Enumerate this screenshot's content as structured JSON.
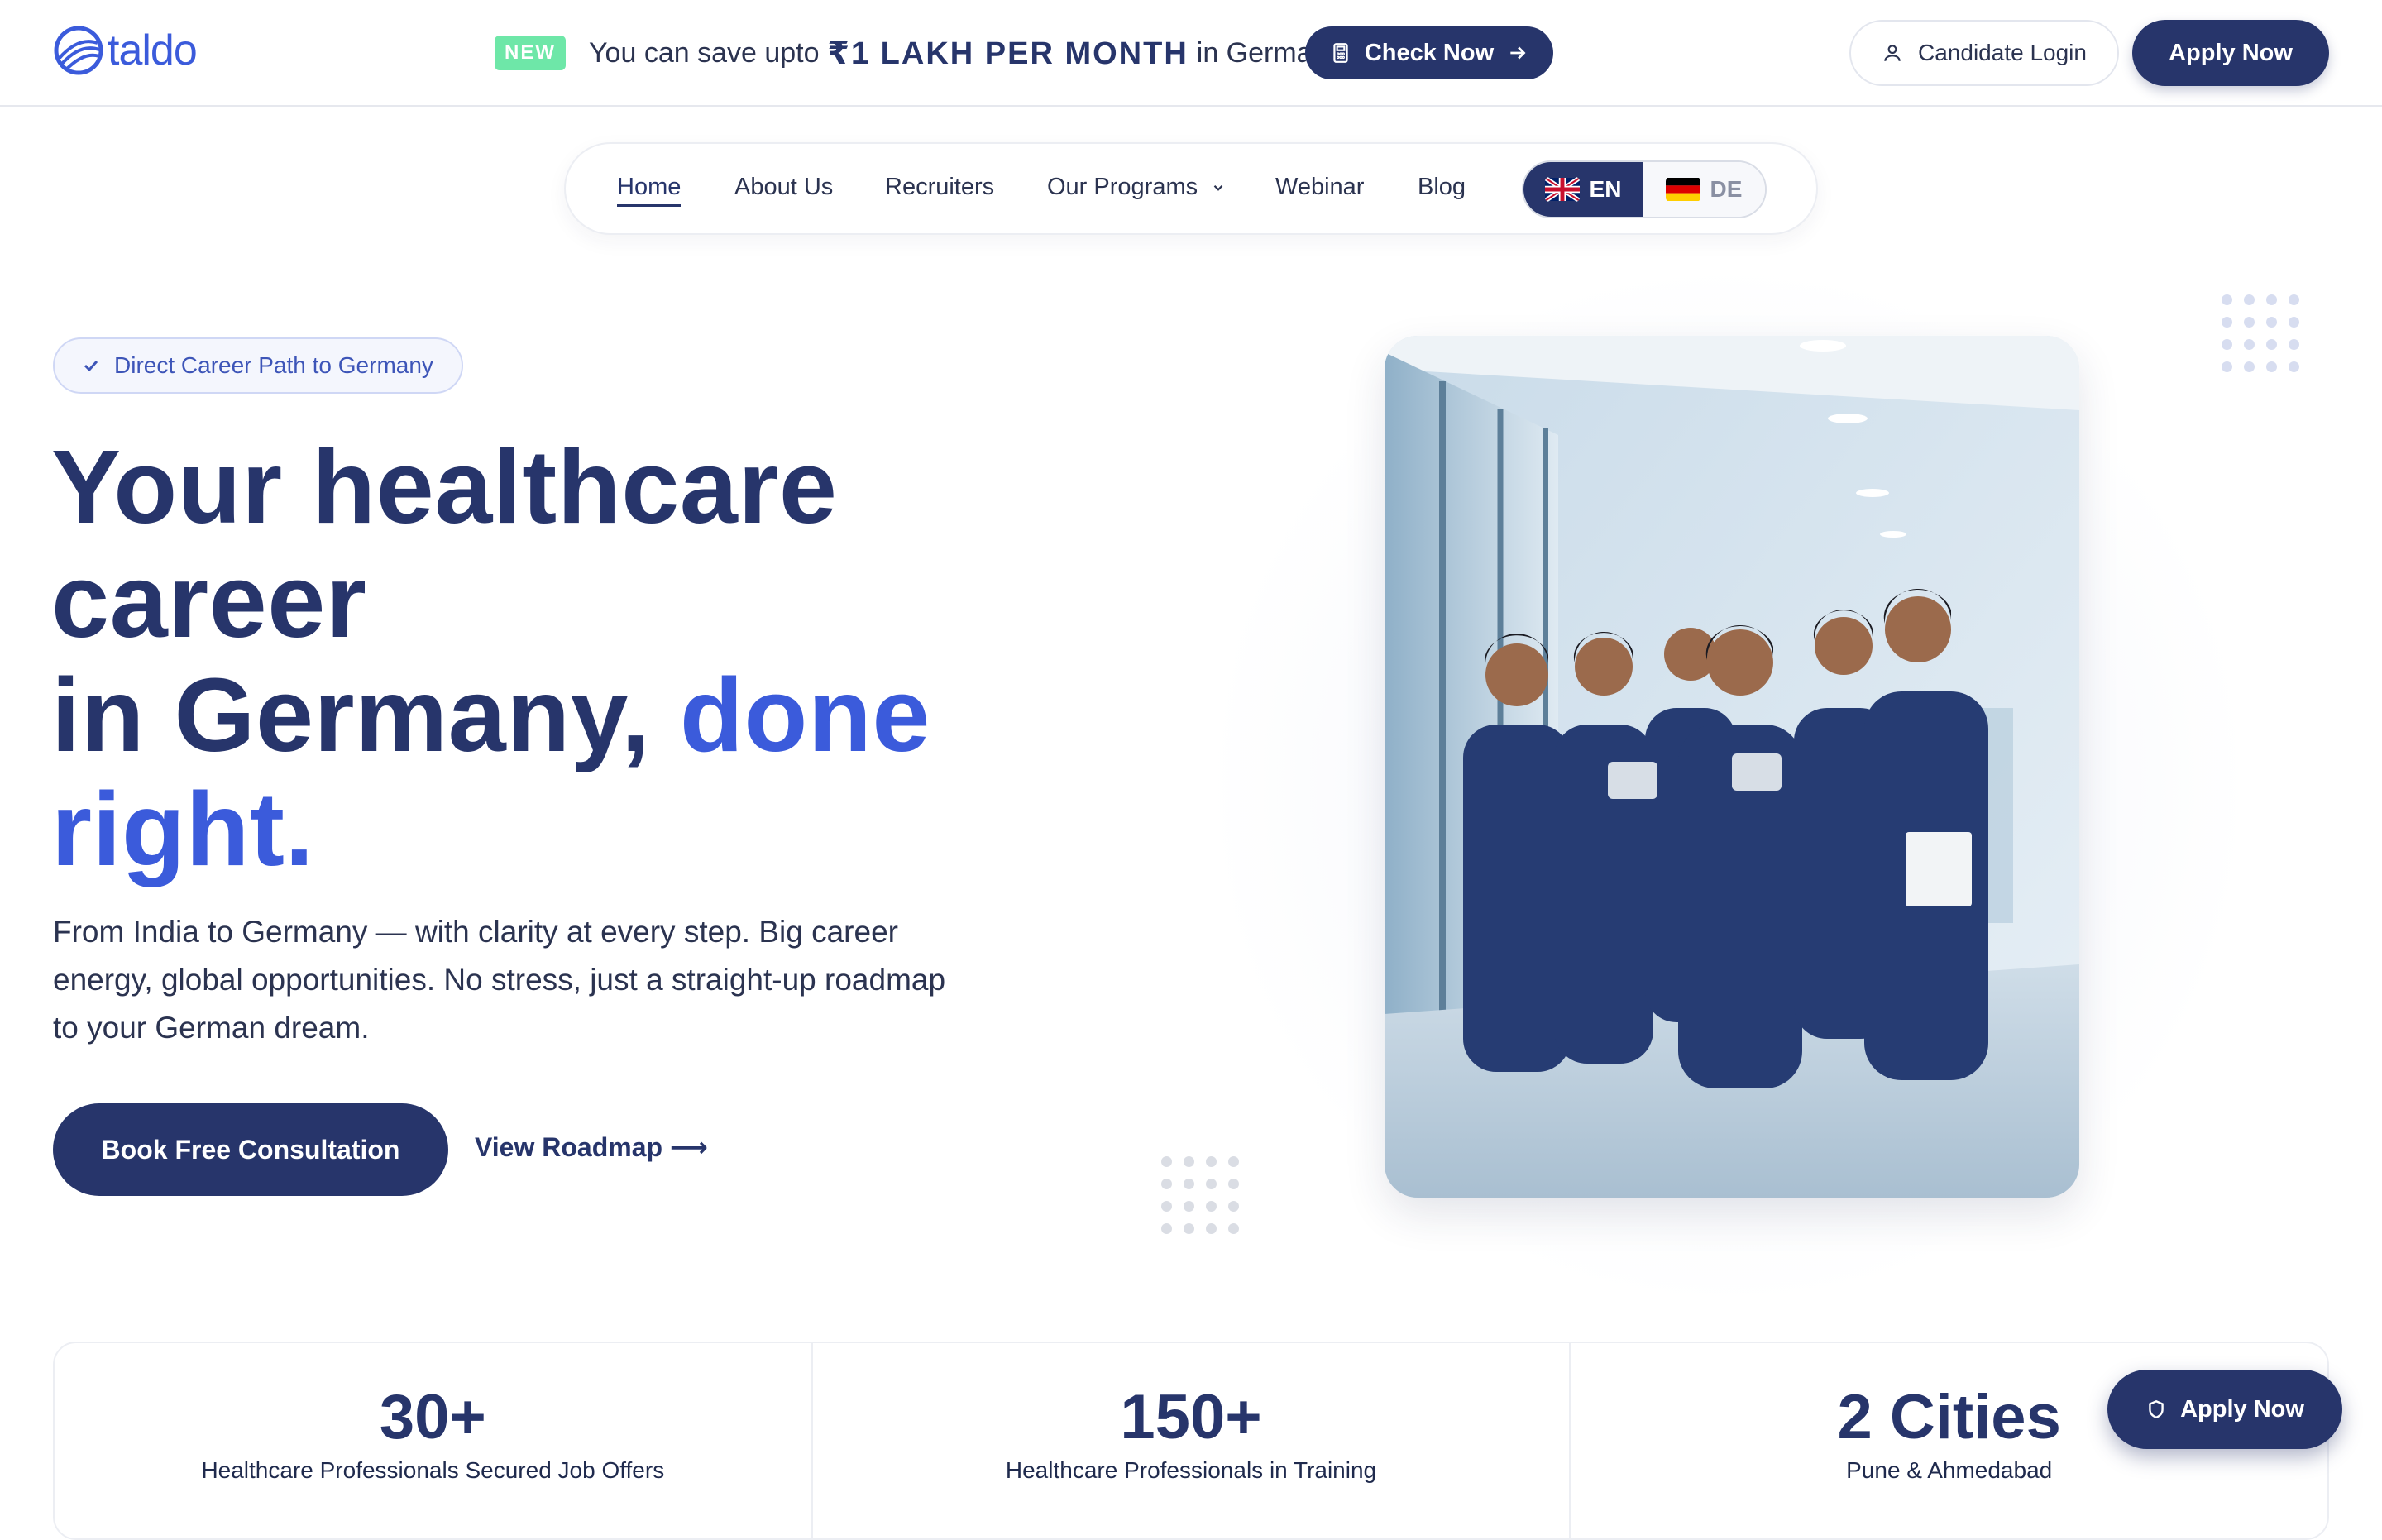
{
  "brand": {
    "name": "taldo",
    "logo_icon": "globe-logo-icon"
  },
  "promo": {
    "badge": "NEW",
    "text_pre": "You can save upto",
    "text_strong": "₹1 LAKH PER MONTH",
    "text_post": "in Germany",
    "cta_label": "Check Now",
    "cta_icon": "calculator-icon"
  },
  "header": {
    "login_label": "Candidate Login",
    "login_icon": "user-icon",
    "apply_label": "Apply Now"
  },
  "nav": {
    "items": [
      {
        "label": "Home",
        "active": true
      },
      {
        "label": "About Us"
      },
      {
        "label": "Recruiters"
      },
      {
        "label": "Our Programs",
        "has_dropdown": true
      },
      {
        "label": "Webinar"
      },
      {
        "label": "Blog"
      }
    ],
    "languages": [
      {
        "code": "EN",
        "flag": "uk-flag-icon",
        "selected": true
      },
      {
        "code": "DE",
        "flag": "germany-flag-icon",
        "selected": false
      }
    ]
  },
  "hero": {
    "badge": "Direct Career Path to Germany",
    "title_line1": "Your healthcare",
    "title_line2": "career",
    "title_line3_plain": "in Germany, ",
    "title_line3_accent": "done",
    "title_line4_accent": "right.",
    "description": "From India to Germany — with clarity at every step. Big career energy, global opportunities. No stress, just a straight-up roadmap to your German dream.",
    "primary_cta": "Book Free Consultation",
    "secondary_cta": "View Roadmap ⟶",
    "image_description": "Group of healthcare professionals in navy scrubs in a hospital corridor"
  },
  "stats": [
    {
      "value": "30+",
      "label": "Healthcare Professionals Secured Job Offers"
    },
    {
      "value": "150+",
      "label": "Healthcare Professionals in Training"
    },
    {
      "value": "2 Cities",
      "label": "Pune & Ahmedabad"
    }
  ],
  "floating_cta": {
    "label": "Apply Now",
    "icon": "shield-icon"
  },
  "colors": {
    "primary": "#27356b",
    "accent": "#3b5bdb",
    "new_badge": "#6ee7a8"
  }
}
